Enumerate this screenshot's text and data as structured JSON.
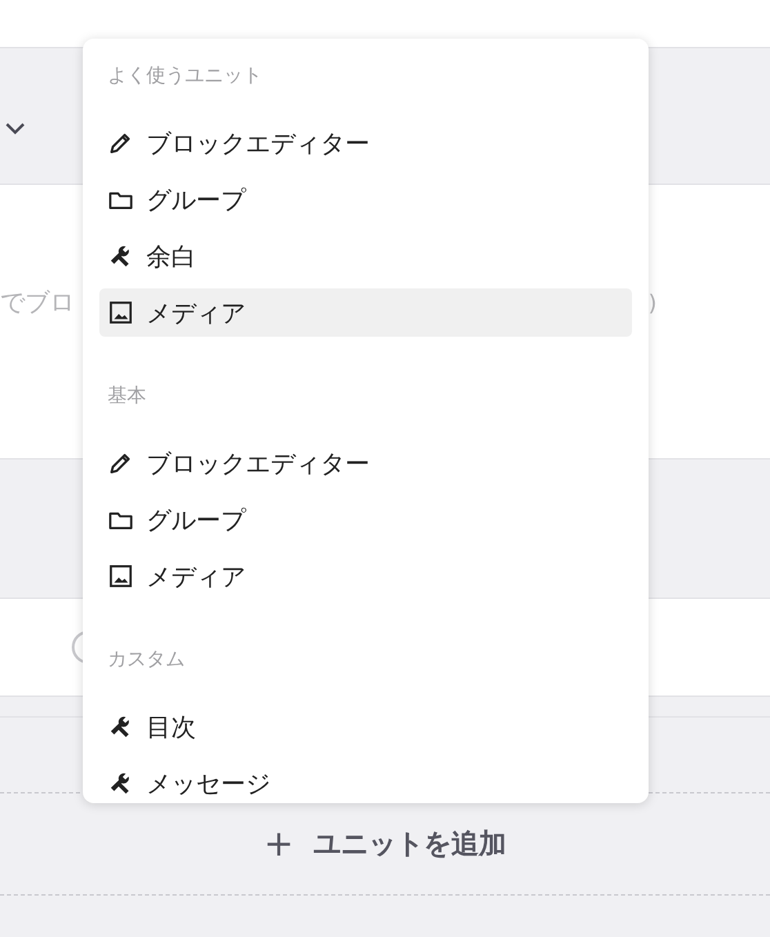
{
  "background": {
    "field_text": "でブロ",
    "field_text_end": ")"
  },
  "unit_menu": {
    "sections": [
      {
        "title": "よく使うユニット",
        "items": [
          {
            "kind": "pencil",
            "label": "ブロックエディター",
            "selected": false
          },
          {
            "kind": "folder",
            "label": "グループ",
            "selected": false
          },
          {
            "kind": "wrench",
            "label": "余白",
            "selected": false
          },
          {
            "kind": "image",
            "label": "メディア",
            "selected": true
          }
        ]
      },
      {
        "title": "基本",
        "items": [
          {
            "kind": "pencil",
            "label": "ブロックエディター",
            "selected": false
          },
          {
            "kind": "folder",
            "label": "グループ",
            "selected": false
          },
          {
            "kind": "image",
            "label": "メディア",
            "selected": false
          }
        ]
      },
      {
        "title": "カスタム",
        "items": [
          {
            "kind": "wrench",
            "label": "目次",
            "selected": false
          },
          {
            "kind": "wrench",
            "label": "メッセージ",
            "selected": false
          }
        ]
      }
    ]
  },
  "add_button": {
    "icon": "+",
    "label": "ユニットを追加"
  }
}
